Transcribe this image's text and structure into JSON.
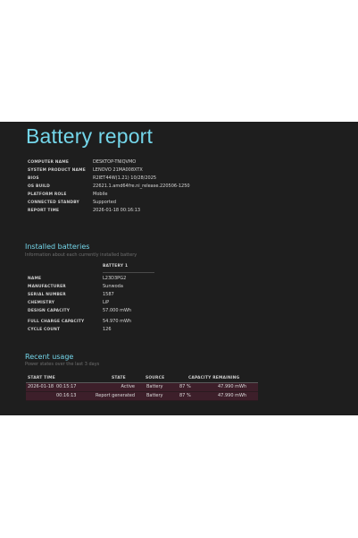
{
  "report": {
    "title": "Battery report"
  },
  "system_info": [
    {
      "label": "COMPUTER NAME",
      "value": "DESKTOP-TNIQVMO"
    },
    {
      "label": "SYSTEM PRODUCT NAME",
      "value": "LENOVO 21MA008XTX"
    },
    {
      "label": "BIOS",
      "value": "R2IET44W(1.21) 10/28/2025"
    },
    {
      "label": "OS BUILD",
      "value": "22621.1.amd64fre.ni_release.220506-1250"
    },
    {
      "label": "PLATFORM ROLE",
      "value": "Mobile"
    },
    {
      "label": "CONNECTED STANDBY",
      "value": "Supported"
    },
    {
      "label": "REPORT TIME",
      "value": "2026-01-18   00:16:13"
    }
  ],
  "installed_batteries": {
    "title": "Installed batteries",
    "subtitle": "Information about each currently installed battery",
    "column_header": "BATTERY 1",
    "rows": [
      {
        "label": "NAME",
        "value": "L23D3PG2"
      },
      {
        "label": "MANUFACTURER",
        "value": "Sunwoda"
      },
      {
        "label": "SERIAL NUMBER",
        "value": "1587"
      },
      {
        "label": "CHEMISTRY",
        "value": "LiP"
      },
      {
        "label": "DESIGN CAPACITY",
        "value": "57.000 mWh"
      },
      {
        "label": "FULL CHARGE CAPACITY",
        "value": "54.970 mWh"
      },
      {
        "label": "CYCLE COUNT",
        "value": "126"
      }
    ]
  },
  "recent_usage": {
    "title": "Recent usage",
    "subtitle": "Power states over the last 3 days",
    "headers": {
      "start_time": "START TIME",
      "state": "STATE",
      "source": "SOURCE",
      "capacity": "CAPACITY REMAINING"
    },
    "rows": [
      {
        "date": "2026-01-18",
        "time": "00:15:17",
        "state": "Active",
        "source": "Battery",
        "percent": "87 %",
        "mwh": "47.990 mWh"
      },
      {
        "date": "",
        "time": "00:16:13",
        "state": "Report generated",
        "source": "Battery",
        "percent": "87 %",
        "mwh": "47.990 mWh"
      }
    ]
  },
  "colors": {
    "background": "#1e1e1e",
    "accent": "#74d6ea",
    "row_highlight": "#3d1f2a"
  }
}
